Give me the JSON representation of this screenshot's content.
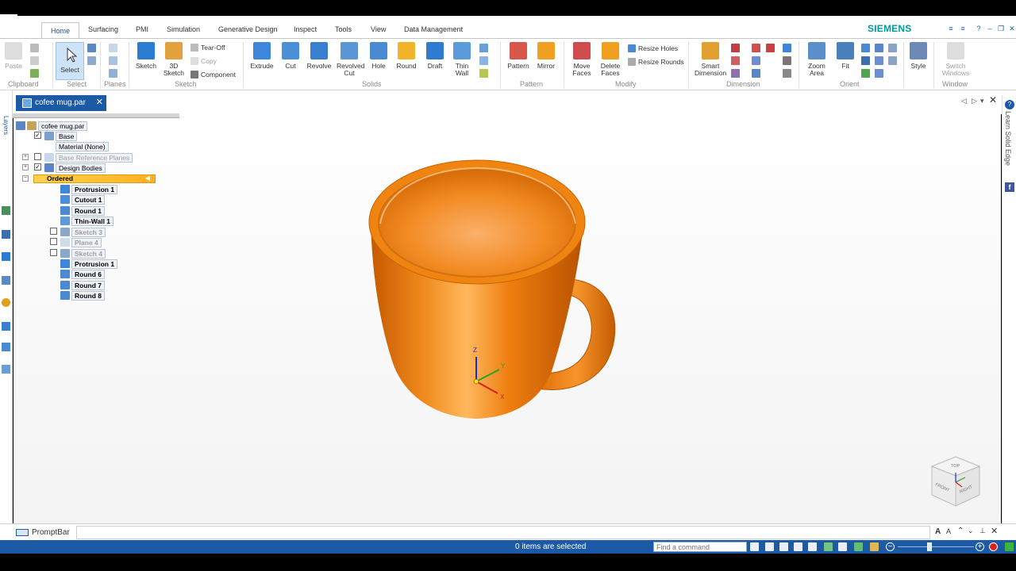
{
  "ribbon_tabs": [
    "Home",
    "Surfacing",
    "PMI",
    "Simulation",
    "Generative Design",
    "Inspect",
    "Tools",
    "View",
    "Data Management"
  ],
  "brand": "SIEMENS",
  "groups": {
    "clipboard": {
      "label": "Clipboard",
      "paste": "Paste"
    },
    "select": {
      "label": "Select",
      "select": "Select"
    },
    "planes": {
      "label": "Planes"
    },
    "sketch": {
      "label": "Sketch",
      "sketch": "Sketch",
      "sketch3d": "3D Sketch",
      "tearoff": "Tear-Off",
      "copy": "Copy",
      "component": "Component"
    },
    "solids": {
      "label": "Solids",
      "extrude": "Extrude",
      "cut": "Cut",
      "revolve": "Revolve",
      "revolved_cut": "Revolved Cut",
      "hole": "Hole",
      "round": "Round",
      "draft": "Draft",
      "thin_wall": "Thin Wall"
    },
    "pattern": {
      "label": "Pattern",
      "pattern": "Pattern",
      "mirror": "Mirror"
    },
    "modify": {
      "label": "Modify",
      "move_faces": "Move Faces",
      "delete_faces": "Delete Faces",
      "resize_holes": "Resize Holes",
      "resize_rounds": "Resize Rounds"
    },
    "dimension": {
      "label": "Dimension",
      "smart_dimension": "Smart Dimension"
    },
    "orient": {
      "label": "Orient",
      "zoom_area": "Zoom Area",
      "fit": "Fit"
    },
    "style": {
      "label": "Style"
    },
    "window": {
      "label": "Window",
      "switch_windows": "Switch Windows"
    }
  },
  "document_tab": "cofee mug.par",
  "right_panel_label": "Learn Solid Edge",
  "left_panel_label": "Layers",
  "tree": {
    "root": "cofee mug.par",
    "base": "Base",
    "material": "Material (None)",
    "base_planes": "Base Reference Planes",
    "design_bodies": "Design Bodies",
    "ordered": "Ordered",
    "features": [
      "Protrusion 1",
      "Cutout 1",
      "Round 1",
      "Thin-Wall 1",
      "Sketch 3",
      "Plane 4",
      "Sketch 4",
      "Protrusion 1",
      "Round 6",
      "Round 7",
      "Round 8"
    ]
  },
  "triad": {
    "x": "X",
    "y": "Y",
    "z": "Z"
  },
  "viewcube": {
    "top": "TOP",
    "front": "FRONT",
    "right": "RIGHT"
  },
  "promptbar_label": "PromptBar",
  "status_text": "0 items are selected",
  "command_placeholder": "Find a command",
  "colors": {
    "accent": "#1c5aa6",
    "brand": "#00999c",
    "model": "#e87a0d"
  }
}
